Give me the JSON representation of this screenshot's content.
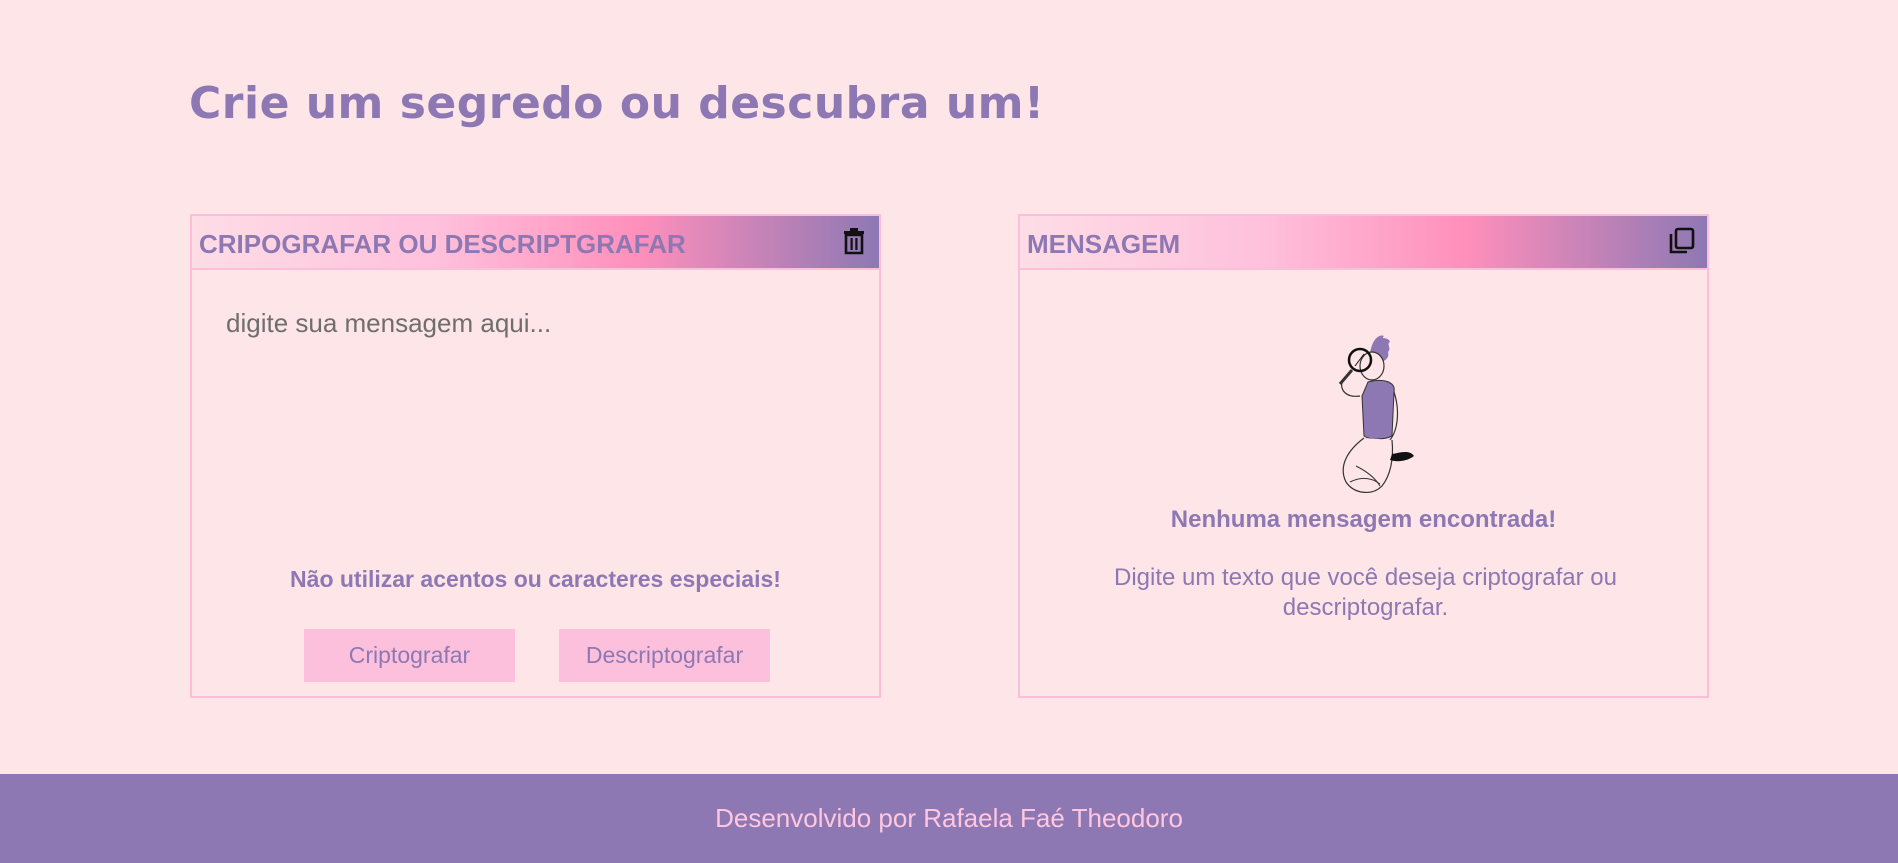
{
  "page": {
    "title": "Crie um segredo ou descubra um!"
  },
  "input_panel": {
    "header": "CRIPOGRAFAR OU DESCRIPTGRAFAR",
    "header_icon": "trash-icon",
    "textarea_placeholder": "digite sua mensagem aqui...",
    "textarea_value": "",
    "warning": "Não utilizar acentos ou caracteres especiais!",
    "encrypt_label": "Criptografar",
    "decrypt_label": "Descriptografar"
  },
  "output_panel": {
    "header": "MENSAGEM",
    "header_icon": "copy-icon",
    "empty_title": "Nenhuma mensagem encontrada!",
    "empty_description": "Digite um texto que você deseja criptografar ou descriptografar."
  },
  "footer": {
    "text": "Desenvolvido por Rafaela Faé Theodoro"
  },
  "colors": {
    "background": "#fee5e7",
    "accent_purple": "#8e78b4",
    "accent_pink": "#fdc0dc",
    "hot_pink": "#ff8fbb",
    "footer_text": "#ffc6de"
  }
}
